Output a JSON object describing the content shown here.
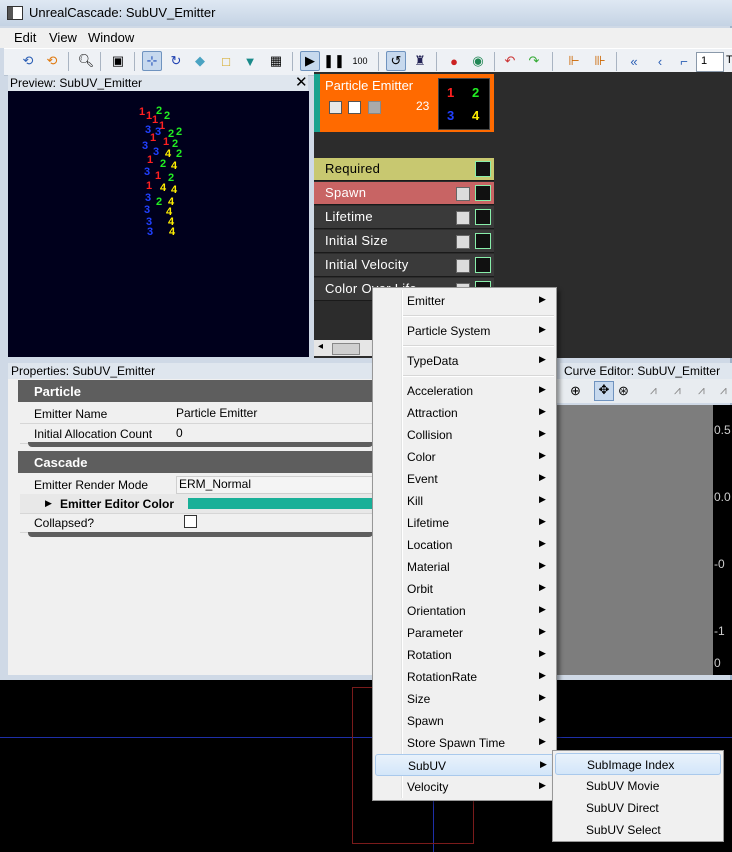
{
  "window": {
    "title": "UnrealCascade: SubUV_Emitter"
  },
  "menubar": {
    "items": [
      "Edit",
      "View",
      "Window"
    ]
  },
  "toolbar": {
    "rate_label": "100",
    "lod_value": "1",
    "lod_trailing": "To"
  },
  "preview": {
    "title": "Preview: SubUV_Emitter",
    "close_label": "✕",
    "colors": {
      "one": "#ff2020",
      "two": "#22ee22",
      "three": "#2040ff",
      "four": "#ffee00"
    }
  },
  "emitter": {
    "name": "Particle Emitter",
    "count": "23",
    "thumb": [
      "1",
      "2",
      "3",
      "4"
    ],
    "modules": [
      {
        "label": "Required",
        "bg": "#c8c870",
        "fg": "#000000"
      },
      {
        "label": "Spawn",
        "bg": "#c86464",
        "fg": "#ffffff"
      },
      {
        "label": "Lifetime",
        "bg": "#3a3a3a",
        "fg": "#ffffff"
      },
      {
        "label": "Initial Size",
        "bg": "#3a3a3a",
        "fg": "#ffffff"
      },
      {
        "label": "Initial Velocity",
        "bg": "#3a3a3a",
        "fg": "#ffffff"
      },
      {
        "label": "Color Over Life",
        "bg": "#3a3a3a",
        "fg": "#ffffff"
      }
    ]
  },
  "properties": {
    "title": "Properties: SubUV_Emitter",
    "categories": {
      "particle": "Particle",
      "cascade": "Cascade"
    },
    "rows": {
      "emitter_name": {
        "key": "Emitter Name",
        "value": "Particle Emitter"
      },
      "initial_allocation": {
        "key": "Initial Allocation Count",
        "value": "0"
      },
      "render_mode": {
        "key": "Emitter Render Mode",
        "value": "ERM_Normal"
      },
      "editor_color": {
        "key": "Emitter Editor Color",
        "color": "#19b098"
      },
      "collapsed": {
        "key": "Collapsed?"
      }
    }
  },
  "curve_editor": {
    "title": "Curve Editor: SubUV_Emitter",
    "axis_labels": [
      "0.5",
      "0.0",
      "-0",
      "-1",
      "0"
    ]
  },
  "context_menu": {
    "group1": [
      "Emitter"
    ],
    "group2": [
      "Particle System"
    ],
    "group3": [
      "TypeData"
    ],
    "group4": [
      "Acceleration",
      "Attraction",
      "Collision",
      "Color",
      "Event",
      "Kill",
      "Lifetime",
      "Location",
      "Material",
      "Orbit",
      "Orientation",
      "Parameter",
      "Rotation",
      "RotationRate",
      "Size",
      "Spawn",
      "Store Spawn Time",
      "SubUV",
      "Velocity"
    ],
    "highlighted": "SubUV"
  },
  "submenu": {
    "items": [
      "SubImage Index",
      "SubUV Movie",
      "SubUV Direct",
      "SubUV Select"
    ],
    "highlighted": "SubImage Index"
  }
}
